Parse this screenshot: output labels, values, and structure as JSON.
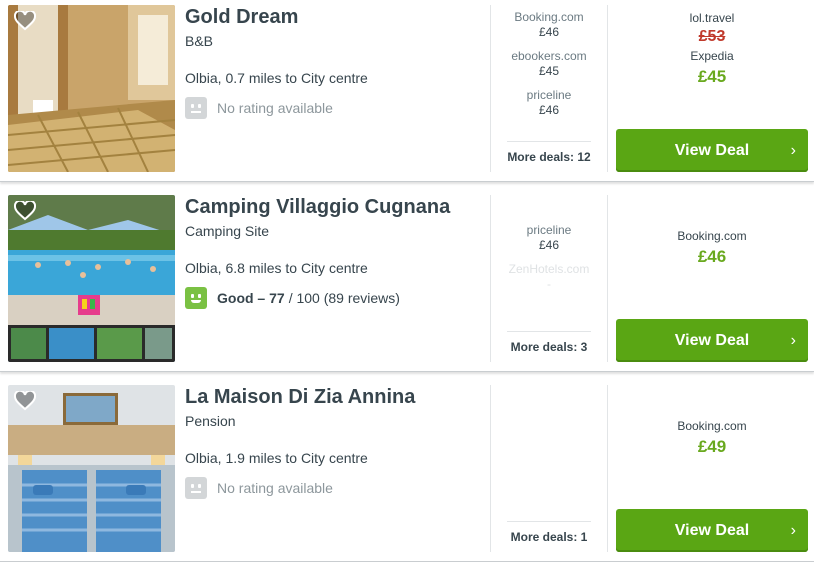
{
  "listings": [
    {
      "name": "Gold Dream",
      "type": "B&B",
      "location": "Olbia, 0.7 miles to City centre",
      "rating": {
        "has": false,
        "text": "No rating available"
      },
      "deals": [
        {
          "site": "Booking.com",
          "price": "£46"
        },
        {
          "site": "ebookers.com",
          "price": "£45"
        },
        {
          "site": "priceline",
          "price": "£46"
        }
      ],
      "more_deals": "More deals: 12",
      "best": {
        "top_site": "lol.travel",
        "old_price": "£53",
        "site": "Expedia",
        "price": "£45"
      },
      "cta": "View Deal"
    },
    {
      "name": "Camping Villaggio Cugnana",
      "type": "Camping Site",
      "location": "Olbia, 6.8 miles to City centre",
      "rating": {
        "has": true,
        "label": "Good – 77",
        "rest": "/ 100 (89 reviews)"
      },
      "deals": [
        {
          "site": "priceline",
          "price": "£46"
        },
        {
          "site": "ZenHotels.com",
          "price": "-"
        }
      ],
      "more_deals": "More deals: 3",
      "best": {
        "site": "Booking.com",
        "price": "£46"
      },
      "cta": "View Deal"
    },
    {
      "name": "La Maison Di Zia Annina",
      "type": "Pension",
      "location": "Olbia, 1.9 miles to City centre",
      "rating": {
        "has": false,
        "text": "No rating available"
      },
      "deals": [],
      "more_deals": "More deals: 1",
      "best": {
        "site": "Booking.com",
        "price": "£49"
      },
      "cta": "View Deal"
    }
  ],
  "icons": {
    "favorite": "heart-outline-icon",
    "cta_arrow": "chevron-right-icon",
    "rating_face": "smiley-face-icon"
  },
  "colors": {
    "cta": "#5aa614",
    "price_green": "#69a91e",
    "strike_red": "#c0392b",
    "rating_green": "#7ac143"
  }
}
